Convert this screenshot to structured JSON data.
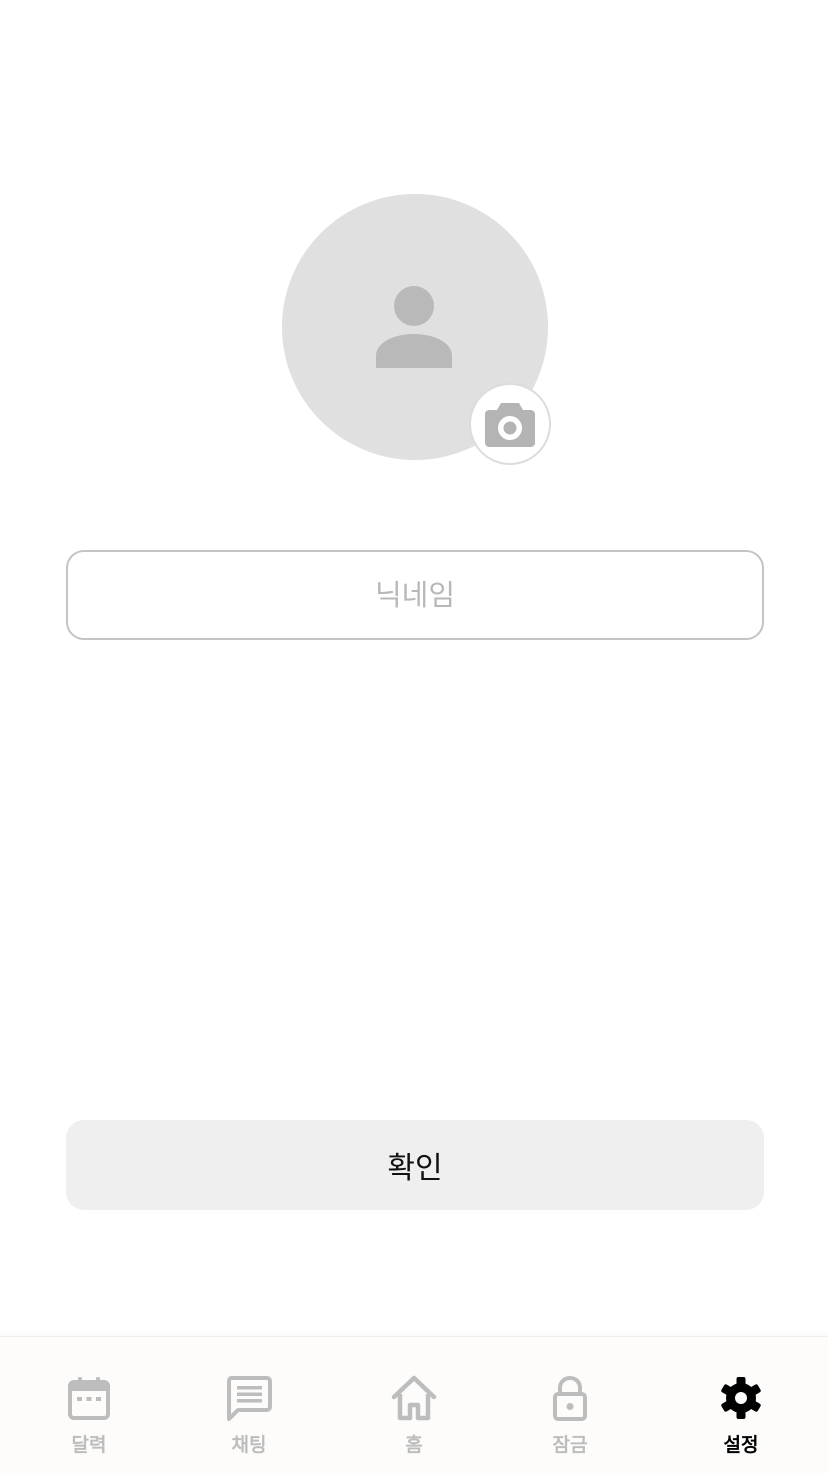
{
  "profile": {
    "avatar_icon": "person-icon",
    "camera_icon": "camera-icon"
  },
  "nickname": {
    "placeholder": "닉네임",
    "value": ""
  },
  "confirm_button": {
    "label": "확인"
  },
  "bottom_nav": {
    "active_index": 4,
    "items": [
      {
        "label": "달력",
        "icon": "calendar-icon"
      },
      {
        "label": "채팅",
        "icon": "chat-icon"
      },
      {
        "label": "홈",
        "icon": "home-icon"
      },
      {
        "label": "잠금",
        "icon": "lock-icon"
      },
      {
        "label": "설정",
        "icon": "gear-icon"
      }
    ]
  },
  "colors": {
    "inactive": "#bdbdbd",
    "active": "#000000",
    "avatar_bg": "#e0e0e0",
    "avatar_fg": "#b8b8b8",
    "button_bg": "#efefef"
  }
}
